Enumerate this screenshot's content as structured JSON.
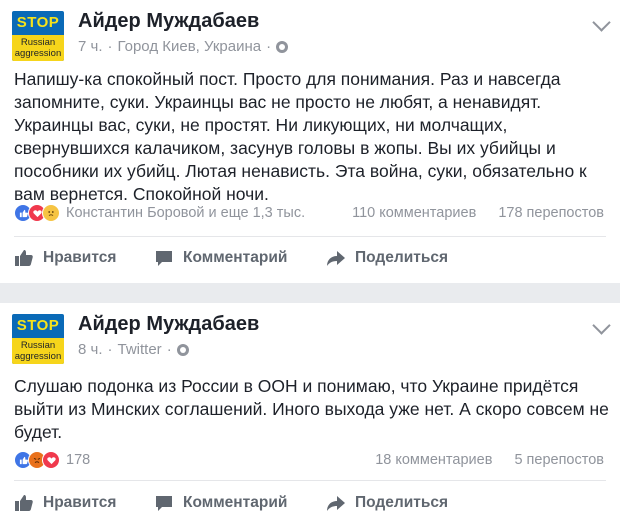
{
  "posts": [
    {
      "avatar": {
        "stop": "STOP",
        "line1": "Russian",
        "line2": "aggression"
      },
      "author": "Айдер Муждабаев",
      "time": "7 ч.",
      "location": "Город Киев, Украина",
      "text": "Напишу-ка спокойный пост. Просто для понимания. Раз и навсегда запомните, суки. Украинцы вас не просто не любят, а ненавидят. Украинцы вас, суки, не простят. Ни ликующих, ни молчащих, свернувшихся калачиком, засунув головы в жопы. Вы их убийцы и пособники их убийц. Лютая ненависть. Эта война, суки, обязательно к вам вернется. Спокойной ночи.",
      "reactions_text": "Константин Боровой и еще 1,3 тыс.",
      "comments": "110 комментариев",
      "shares": "178 перепостов",
      "actions": {
        "like": "Нравится",
        "comment": "Комментарий",
        "share": "Поделиться"
      }
    },
    {
      "avatar": {
        "stop": "STOP",
        "line1": "Russian",
        "line2": "aggression"
      },
      "author": "Айдер Муждабаев",
      "time": "8 ч.",
      "location": "Twitter",
      "text": "Слушаю подонка из России в ООН и понимаю, что Украине придётся выйти из Минских соглашений. Иного выхода уже нет. А скоро совсем не будет.",
      "reactions_text": "178",
      "comments": "18 комментариев",
      "shares": "5 перепостов",
      "actions": {
        "like": "Нравится",
        "comment": "Комментарий",
        "share": "Поделиться"
      }
    }
  ],
  "colors": {
    "background": "#e9ebee",
    "secondary_text": "#90949c",
    "action_text": "#606770",
    "like_blue": "#3f75e6"
  }
}
